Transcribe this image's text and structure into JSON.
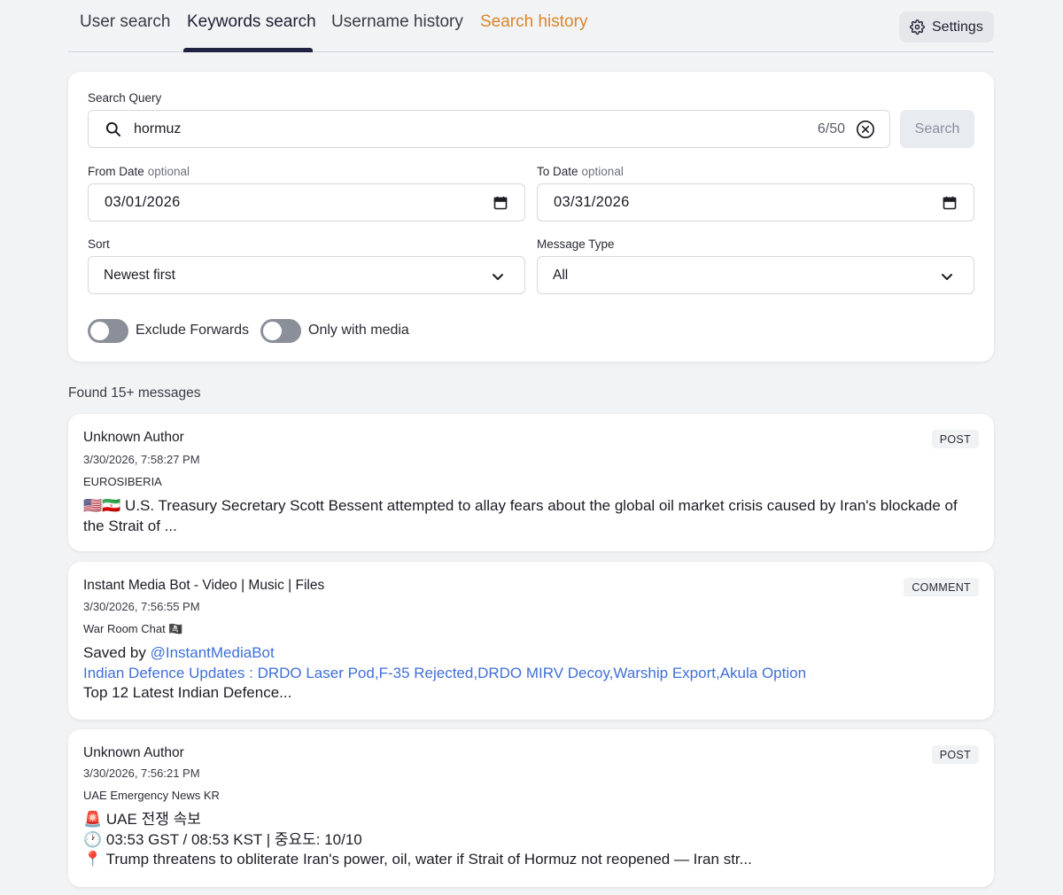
{
  "tabs": {
    "user_search": "User search",
    "keywords_search": "Keywords search",
    "username_history": "Username history",
    "search_history": "Search history",
    "settings": "Settings"
  },
  "form": {
    "query_label": "Search Query",
    "query_value": "hormuz",
    "query_count": "6/50",
    "search_button": "Search",
    "from_label": "From Date",
    "to_label": "To Date",
    "optional": "optional",
    "from_value": "03/01/2026",
    "to_value": "03/31/2026",
    "sort_label": "Sort",
    "sort_value": "Newest first",
    "type_label": "Message Type",
    "type_value": "All",
    "exclude_forwards": "Exclude Forwards",
    "only_media": "Only with media"
  },
  "results": {
    "found": "Found 15+ messages",
    "messages": [
      {
        "author": "Unknown Author",
        "time": "3/30/2026, 7:58:27 PM",
        "channel": "EUROSIBERIA",
        "badge": "POST",
        "text": "🇺🇸🇮🇷 U.S. Treasury Secretary Scott Bessent attempted to allay fears about the global oil market crisis caused by Iran's blockade of the Strait of ..."
      },
      {
        "author": "Instant Media Bot - Video | Music | Files",
        "time": "3/30/2026, 7:56:55 PM",
        "channel": "War Room Chat 🏴‍☠️",
        "badge": "COMMENT",
        "line1_prefix": "Saved by ",
        "line1_link": "@InstantMediaBot",
        "line2": "Indian Defence Updates : DRDO Laser Pod,F-35 Rejected,DRDO MIRV Decoy,Warship Export,Akula Option",
        "line3": "Top 12 Latest Indian Defence..."
      },
      {
        "author": "Unknown Author",
        "time": "3/30/2026, 7:56:21 PM",
        "channel": "UAE Emergency News KR",
        "badge": "POST",
        "line1": "🚨 UAE 전쟁 속보",
        "line2": "🕐 03:53 GST / 08:53 KST | 중요도: 10/10",
        "line3": "📍 Trump threatens to obliterate Iran's power, oil, water if Strait of Hormuz not reopened — Iran str..."
      }
    ]
  }
}
